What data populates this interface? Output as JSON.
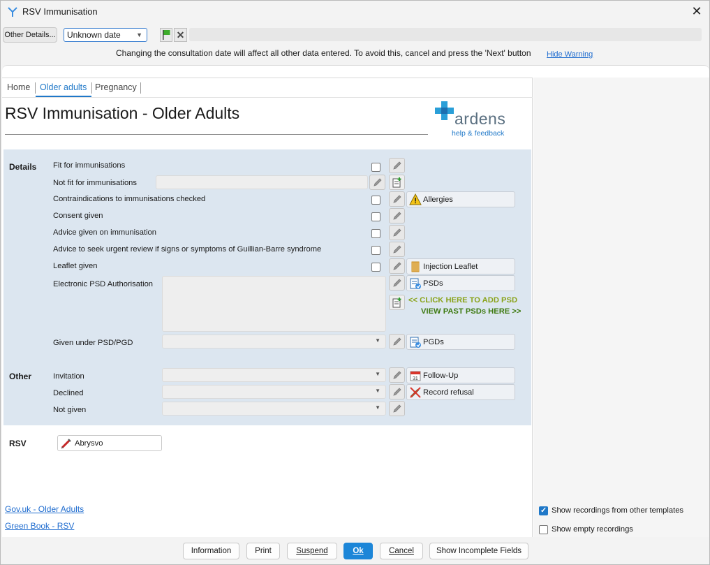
{
  "window": {
    "title": "RSV Immunisation",
    "close_glyph": "✕"
  },
  "toolbar": {
    "other_details": "Other Details...",
    "date_value": "Unknown date",
    "warning": "Changing the consultation date will affect all other data entered. To avoid this, cancel and press the 'Next' button",
    "hide_warning": "Hide Warning"
  },
  "tabs": [
    {
      "label": "Home"
    },
    {
      "label": "Older adults"
    },
    {
      "label": "Pregnancy"
    }
  ],
  "page": {
    "title": "RSV Immunisation - Older Adults",
    "logo_word": "ardens",
    "logo_sub": "help & feedback"
  },
  "sections": {
    "details": "Details",
    "other": "Other",
    "rsv": "RSV"
  },
  "details_rows": [
    "Fit for immunisations",
    "Not fit for immunisations",
    "Contraindications to immunisations checked",
    "Consent given",
    "Advice given on immunisation",
    "Advice to seek urgent review if signs or symptoms of Guillian-Barre syndrome",
    "Leaflet given",
    "Electronic PSD Authorisation",
    "Given under PSD/PGD"
  ],
  "other_rows": [
    "Invitation",
    "Declined",
    "Not given"
  ],
  "side_buttons": {
    "allergies": "Allergies",
    "leaflet": "Injection Leaflet",
    "psds": "PSDs",
    "pgds": "PGDs",
    "follow_up": "Follow-Up",
    "record_refusal": "Record refusal"
  },
  "psd_links": {
    "add": "<< CLICK HERE TO ADD PSD",
    "view": "VIEW PAST PSDs HERE >>"
  },
  "rsv_button": "Abrysvo",
  "links": [
    "Gov.uk - Older Adults",
    "Green Book - RSV"
  ],
  "options": [
    {
      "label": "Show recordings from other templates",
      "checked": true
    },
    {
      "label": "Show empty recordings",
      "checked": false
    }
  ],
  "bottom_buttons": {
    "information": "Information",
    "print": "Print",
    "suspend": "Suspend",
    "ok": "Ok",
    "cancel": "Cancel",
    "incomplete": "Show Incomplete Fields"
  },
  "colors": {
    "accent": "#1f78c8",
    "form_bg": "#dce6f0",
    "psd_add": "#8aa31a",
    "psd_view": "#3e7a11"
  }
}
